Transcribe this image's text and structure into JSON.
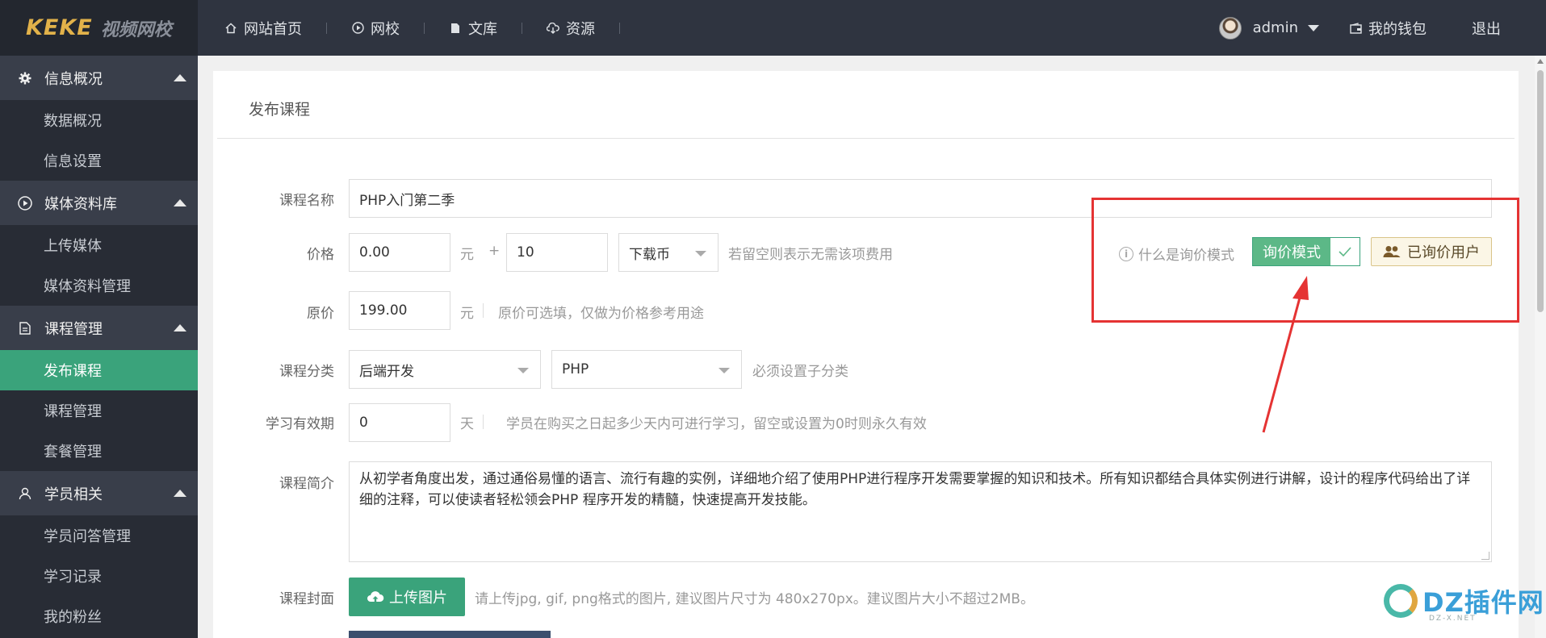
{
  "logo": {
    "mark": "KEKE",
    "text": "视频网校"
  },
  "topnav": [
    {
      "label": "网站首页",
      "icon": "home-icon"
    },
    {
      "label": "网校",
      "icon": "play-icon"
    },
    {
      "label": "文库",
      "icon": "document-icon"
    },
    {
      "label": "资源",
      "icon": "download-cloud-icon"
    }
  ],
  "user": {
    "name": "admin",
    "wallet": "我的钱包",
    "logout": "退出"
  },
  "sidebar": {
    "groups": [
      {
        "label": "信息概况",
        "icon": "gear-icon",
        "items": [
          "数据概况",
          "信息设置"
        ]
      },
      {
        "label": "媒体资料库",
        "icon": "play-circle-icon",
        "items": [
          "上传媒体",
          "媒体资料管理"
        ]
      },
      {
        "label": "课程管理",
        "icon": "document-icon",
        "items": [
          "发布课程",
          "课程管理",
          "套餐管理"
        ],
        "active": "发布课程"
      },
      {
        "label": "学员相关",
        "icon": "user-icon",
        "items": [
          "学员问答管理",
          "学习记录",
          "我的粉丝"
        ]
      }
    ]
  },
  "panel": {
    "title": "发布课程"
  },
  "form": {
    "name": {
      "label": "课程名称",
      "value": "PHP入门第二季"
    },
    "price": {
      "label": "价格",
      "value": "0.00",
      "unit": "元",
      "plus": "+",
      "coin_value": "10",
      "coin_type": "下载币",
      "hint": "若留空则表示无需该项费用"
    },
    "original_price": {
      "label": "原价",
      "value": "199.00",
      "unit": "元",
      "hint": "原价可选填，仅做为价格参考用途"
    },
    "category": {
      "label": "课程分类",
      "main": "后端开发",
      "sub": "PHP",
      "hint": "必须设置子分类"
    },
    "validity": {
      "label": "学习有效期",
      "value": "0",
      "unit": "天",
      "hint": "学员在购买之日起多少天内可进行学习，留空或设置为0时则永久有效"
    },
    "intro": {
      "label": "课程简介",
      "value": "从初学者角度出发，通过通俗易懂的语言、流行有趣的实例，详细地介绍了使用PHP进行程序开发需要掌握的知识和技术。所有知识都结合具体实例进行讲解，设计的程序代码给出了详细的注释，可以使读者轻松领会PHP 程序开发的精髓，快速提高开发技能。"
    },
    "cover": {
      "label": "课程封面",
      "button": "上传图片",
      "hint": "请上传jpg, gif, png格式的图片, 建议图片尺寸为 480x270px。建议图片大小不超过2MB。"
    }
  },
  "inquiry": {
    "help": "什么是询价模式",
    "toggle_label": "询价模式",
    "toggle_on": true,
    "asked_users": "已询价用户"
  },
  "watermark": {
    "text": "DZ插件网",
    "sub": "DZ-X.NET"
  },
  "colors": {
    "accent": "#3aa37b",
    "annotation": "#e53333",
    "topbar": "#2f3440",
    "sidebar": "#282c35"
  }
}
